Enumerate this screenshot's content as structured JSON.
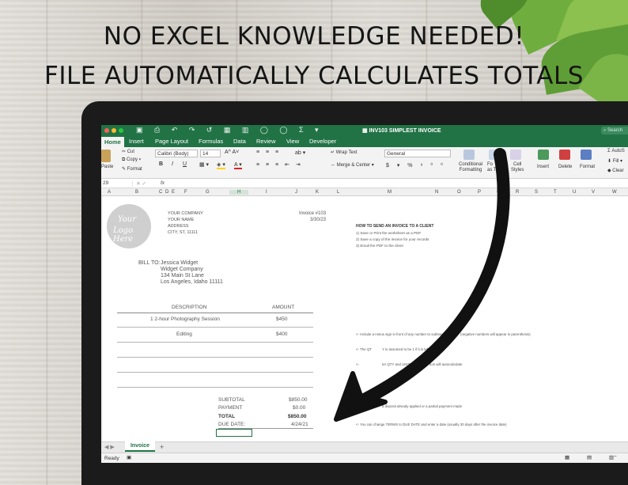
{
  "headline": {
    "line1": "NO EXCEL KNOWLEDGE NEEDED!",
    "line2": "FILE AUTOMATICALLY CALCULATES TOTALS"
  },
  "window": {
    "title": "INV103 SIMPLEST INVOICE",
    "search_placeholder": "Search"
  },
  "ribbon_tabs": [
    "Home",
    "Insert",
    "Page Layout",
    "Formulas",
    "Data",
    "Review",
    "View",
    "Developer"
  ],
  "ribbon": {
    "paste": "Paste",
    "cut": "Cut",
    "copy": "Copy",
    "format": "Format",
    "font_name": "Calibri (Body)",
    "font_size": "14",
    "bold": "B",
    "italic": "I",
    "underline": "U",
    "wrap_text": "Wrap Text",
    "merge_center": "Merge & Center",
    "number_format": "General",
    "conditional_formatting_1": "Conditional",
    "conditional_formatting_2": "Formatting",
    "format_as_table_1": "Fo",
    "format_as_table_2": "as T",
    "cell_styles_1": "Cell",
    "cell_styles_2": "Styles",
    "insert": "Insert",
    "delete": "Delete",
    "format_cells": "Format",
    "autosum": "AutoS",
    "fill": "Fill",
    "clear": "Clear"
  },
  "formula_bar": {
    "cell_ref": "29",
    "fx": "fx"
  },
  "columns": [
    "A",
    "B",
    "C",
    "D",
    "E",
    "F",
    "G",
    "H",
    "I",
    "J",
    "K",
    "L",
    "M",
    "N",
    "O",
    "P",
    "Q",
    "R",
    "S",
    "T",
    "U",
    "V",
    "W"
  ],
  "invoice": {
    "logo_line1": "Your",
    "logo_line2": "Logo Here",
    "company": "YOUR COMPANY",
    "name": "YOUR NAME",
    "address": "ADDRESS",
    "city": "CITY, ST, 11111",
    "invoice_no": "Invoice #103",
    "date": "3/30/23",
    "bill_to_label": "BILL TO:",
    "bill_to_name": "Jessica Widget",
    "bill_to_company": "Widget Company",
    "bill_to_street": "134 Main St Lane",
    "bill_to_city": "Los Angeles, Idaho 11111",
    "col_description": "DESCRIPTION",
    "col_amount": "AMOUNT",
    "items": [
      {
        "desc": "1 2-hour Photography Session",
        "amount": "$450"
      },
      {
        "desc": "Editing",
        "amount": "$400"
      }
    ],
    "subtotal_label": "SUBTOTAL",
    "subtotal": "$850.00",
    "payment_label": "PAYMENT",
    "payment": "$0.00",
    "total_label": "TOTAL",
    "total": "$850.00",
    "due_label": "DUE DATE:",
    "due": "4/24/21"
  },
  "instructions": {
    "title": "HOW TO SEND AN INVOICE TO A CLIENT",
    "step1": "1) Save or Print the worksheet as a PDF",
    "step2": "2) Save a copy of the invoice for your records",
    "step3": "3) Email the PDF to the client",
    "note1": "<- Include a minus sign in front of any number to subtrac",
    "note1b": "(negative numbers will appear in parenthesis)",
    "note2a": "<- The QT",
    "note2b": "Y is assumed to be 1 if it is left blank",
    "note3a": "<- ",
    "note3b": "ter QTY and UNIT PRICE",
    "note3c": "tion will autocalculate",
    "note4": "a deposit already applied or a partial payment made",
    "note5": "<- You can change TERMS to DUE DATE and enter a date (usually 30 days after the invoice date)"
  },
  "sheet_tab": "Invoice",
  "add_sheet": "+",
  "status": "Ready",
  "colors": {
    "excel_green": "#217346",
    "arrow": "#111111"
  }
}
